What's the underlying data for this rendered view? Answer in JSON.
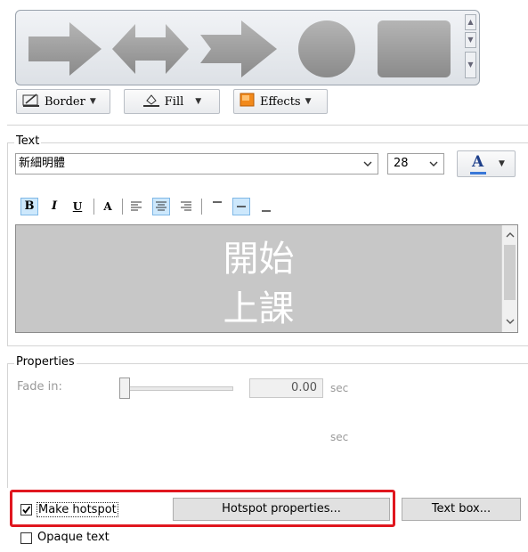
{
  "gallery": {
    "shapes": [
      "arrow-right-icon",
      "double-arrow-icon",
      "notched-arrow-icon",
      "circle-icon",
      "rounded-rect-icon"
    ]
  },
  "style_buttons": {
    "border": "Border",
    "fill": "Fill",
    "effects": "Effects"
  },
  "text_group": {
    "title": "Text",
    "font": "新細明體",
    "size": "28",
    "color_letter": "A",
    "toolbar": {
      "bold": "B",
      "italic": "I",
      "underline": "U",
      "font_color": "A"
    },
    "content": "開始\n上課"
  },
  "properties": {
    "title": "Properties",
    "fade_in_label": "Fade in:",
    "fade_in_value": "0.00",
    "fade_in_level": 0,
    "unit1": "sec",
    "unit2": "sec"
  },
  "bottom": {
    "make_hotspot_label": "Make hotspot",
    "make_hotspot_checked": true,
    "hotspot_properties_button": "Hotspot properties...",
    "text_box_button": "Text box...",
    "opaque_text_label": "Opaque text",
    "opaque_text_checked": false
  },
  "colors": {
    "highlight": "#e0171f",
    "shape_fill": "#9a9a9a",
    "text_background": "#c7c7c7",
    "selected_toolbar": "#cde8fc"
  }
}
